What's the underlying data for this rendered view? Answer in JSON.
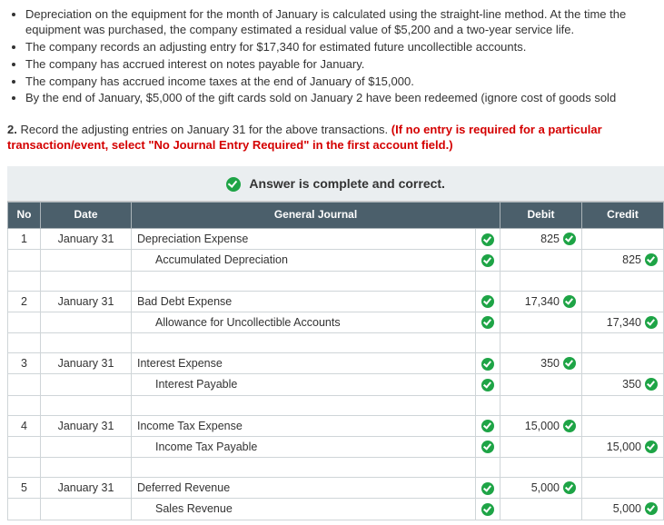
{
  "bullets": [
    "Depreciation on the equipment for the month of January is calculated using the straight-line method. At the time the equipment was purchased, the company estimated a residual value of $5,200 and a two-year service life.",
    "The company records an adjusting entry for $17,340 for estimated future uncollectible accounts.",
    "The company has accrued interest on notes payable for January.",
    "The company has accrued income taxes at the end of January of $15,000.",
    "By the end of January, $5,000 of the gift cards sold on January 2 have been redeemed (ignore cost of goods sold"
  ],
  "question": {
    "num": "2.",
    "text": "Record the adjusting entries on January 31 for the above transactions.",
    "red": "(If no entry is required for a particular transaction/event, select \"No Journal Entry Required\" in the first account field.)"
  },
  "banner": "Answer is complete and correct.",
  "headers": {
    "no": "No",
    "date": "Date",
    "gj": "General Journal",
    "debit": "Debit",
    "credit": "Credit"
  },
  "entries": [
    {
      "no": "1",
      "date": "January 31",
      "lines": [
        {
          "acct": "Depreciation Expense",
          "debit": "825",
          "credit": ""
        },
        {
          "acct": "Accumulated Depreciation",
          "indent": true,
          "debit": "",
          "credit": "825"
        }
      ]
    },
    {
      "no": "2",
      "date": "January 31",
      "lines": [
        {
          "acct": "Bad Debt Expense",
          "debit": "17,340",
          "credit": ""
        },
        {
          "acct": "Allowance for Uncollectible Accounts",
          "indent": true,
          "debit": "",
          "credit": "17,340"
        }
      ]
    },
    {
      "no": "3",
      "date": "January 31",
      "lines": [
        {
          "acct": "Interest Expense",
          "debit": "350",
          "credit": ""
        },
        {
          "acct": "Interest Payable",
          "indent": true,
          "debit": "",
          "credit": "350"
        }
      ]
    },
    {
      "no": "4",
      "date": "January 31",
      "lines": [
        {
          "acct": "Income Tax Expense",
          "debit": "15,000",
          "credit": ""
        },
        {
          "acct": "Income Tax Payable",
          "indent": true,
          "debit": "",
          "credit": "15,000"
        }
      ]
    },
    {
      "no": "5",
      "date": "January 31",
      "lines": [
        {
          "acct": "Deferred Revenue",
          "debit": "5,000",
          "credit": ""
        },
        {
          "acct": "Sales Revenue",
          "indent": true,
          "debit": "",
          "credit": "5,000"
        }
      ]
    }
  ]
}
